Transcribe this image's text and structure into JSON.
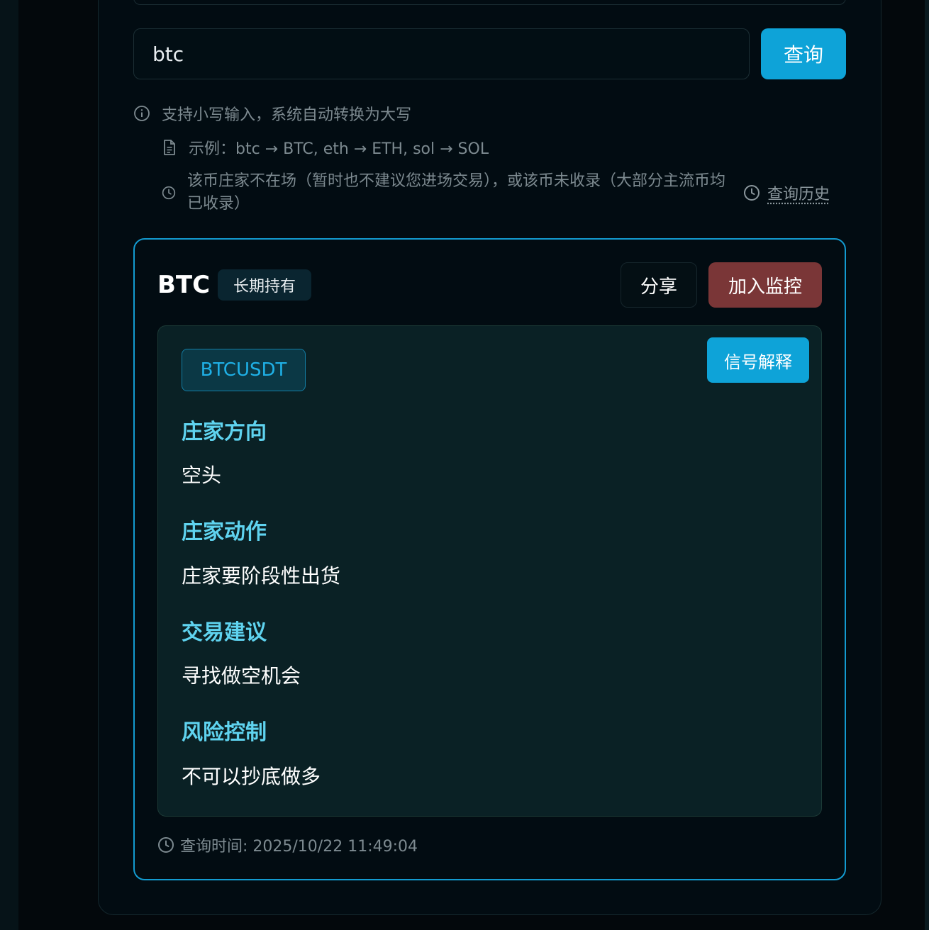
{
  "search": {
    "value": "btc",
    "button_label": "查询"
  },
  "hints": {
    "lowercase": "支持小写输入，系统自动转换为大写",
    "example": "示例：btc → BTC, eth → ETH, sol → SOL",
    "absent": "该币庄家不在场（暂时也不建议您进场交易），或该币未收录（大部分主流币均已收录）",
    "history_link": "查询历史"
  },
  "result": {
    "symbol": "BTC",
    "tag": "长期持有",
    "share_label": "分享",
    "monitor_label": "加入监控",
    "pair": "BTCUSDT",
    "explain_label": "信号解释",
    "sections": [
      {
        "title": "庄家方向",
        "value": "空头"
      },
      {
        "title": "庄家动作",
        "value": "庄家要阶段性出货"
      },
      {
        "title": "交易建议",
        "value": "寻找做空机会"
      },
      {
        "title": "风险控制",
        "value": "不可以抄底做多"
      }
    ],
    "query_time": "查询时间: 2025/10/22 11:49:04"
  },
  "colors": {
    "accent": "#0ea3d8",
    "monitor": "#7a3637",
    "section_title": "#5fd3ef"
  }
}
